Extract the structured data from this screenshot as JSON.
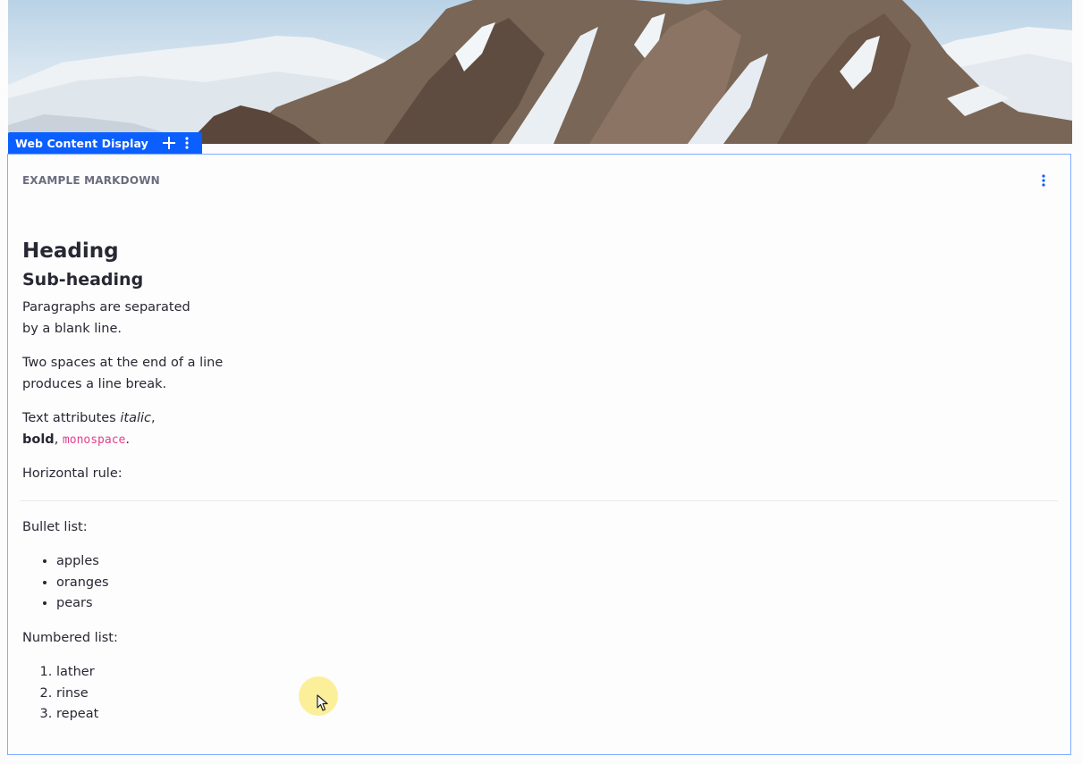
{
  "portlet": {
    "topper_title": "Web Content Display",
    "add_icon": "plus-icon",
    "options_icon": "vertical-ellipsis-icon"
  },
  "panel": {
    "header": "EXAMPLE MARKDOWN",
    "options_icon": "vertical-ellipsis-icon"
  },
  "content": {
    "heading": "Heading",
    "subheading": "Sub-heading",
    "para1_line1": "Paragraphs are separated",
    "para1_line2": "by a blank line.",
    "para2_line1": "Two spaces at the end of a line",
    "para2_line2": "produces a line break.",
    "attr_prefix": "Text attributes ",
    "attr_italic": "italic",
    "attr_comma1": ",",
    "attr_bold": "bold",
    "attr_comma2": ", ",
    "attr_mono": "monospace",
    "attr_period": ".",
    "hr_label": "Horizontal rule:",
    "bullet_label": "Bullet list:",
    "bullets": [
      "apples",
      "oranges",
      "pears"
    ],
    "numbered_label": "Numbered list:",
    "numbered": [
      "lather",
      "rinse",
      "repeat"
    ]
  },
  "colors": {
    "accent": "#0b5fff",
    "panel_border": "#80acff",
    "code": "#e83e8c",
    "header_text": "#6b6c7e"
  }
}
